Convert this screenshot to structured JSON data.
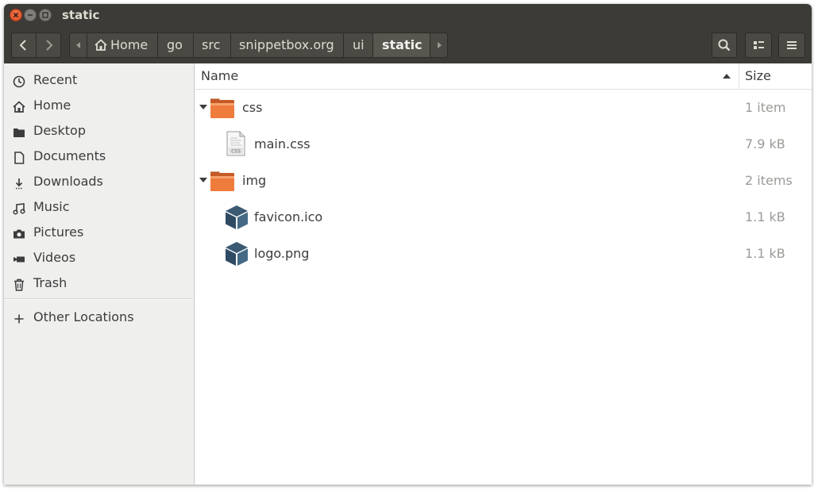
{
  "window": {
    "title": "static"
  },
  "toolbar": {
    "back_icon": "chevron-left-icon",
    "forward_icon": "chevron-right-icon",
    "search_icon": "search-icon",
    "view_icon": "view-options-icon",
    "menu_icon": "hamburger-menu-icon"
  },
  "breadcrumb": {
    "items": [
      {
        "label": "Home",
        "icon": "home-icon"
      },
      {
        "label": "go"
      },
      {
        "label": "src"
      },
      {
        "label": "snippetbox.org"
      },
      {
        "label": "ui"
      },
      {
        "label": "static",
        "active": true
      }
    ]
  },
  "sidebar": {
    "items": [
      {
        "label": "Recent",
        "icon": "clock-icon"
      },
      {
        "label": "Home",
        "icon": "home-icon"
      },
      {
        "label": "Desktop",
        "icon": "folder-icon"
      },
      {
        "label": "Documents",
        "icon": "document-icon"
      },
      {
        "label": "Downloads",
        "icon": "download-icon"
      },
      {
        "label": "Music",
        "icon": "music-icon"
      },
      {
        "label": "Pictures",
        "icon": "camera-icon"
      },
      {
        "label": "Videos",
        "icon": "video-icon"
      },
      {
        "label": "Trash",
        "icon": "trash-icon"
      }
    ],
    "other": {
      "label": "Other Locations",
      "icon": "plus-icon"
    }
  },
  "columns": {
    "name": "Name",
    "size": "Size"
  },
  "files": [
    {
      "name": "css",
      "size": "1 item",
      "type": "folder",
      "expanded": true,
      "depth": 0
    },
    {
      "name": "main.css",
      "size": "7.9 kB",
      "type": "css-file",
      "depth": 1
    },
    {
      "name": "img",
      "size": "2 items",
      "type": "folder",
      "expanded": true,
      "depth": 0
    },
    {
      "name": "favicon.ico",
      "size": "1.1 kB",
      "type": "image-file",
      "depth": 1
    },
    {
      "name": "logo.png",
      "size": "1.1 kB",
      "type": "image-file",
      "depth": 1
    }
  ],
  "colors": {
    "titlebar": "#3c3b37",
    "close_button": "#e95420",
    "folder": "#e9702f"
  }
}
